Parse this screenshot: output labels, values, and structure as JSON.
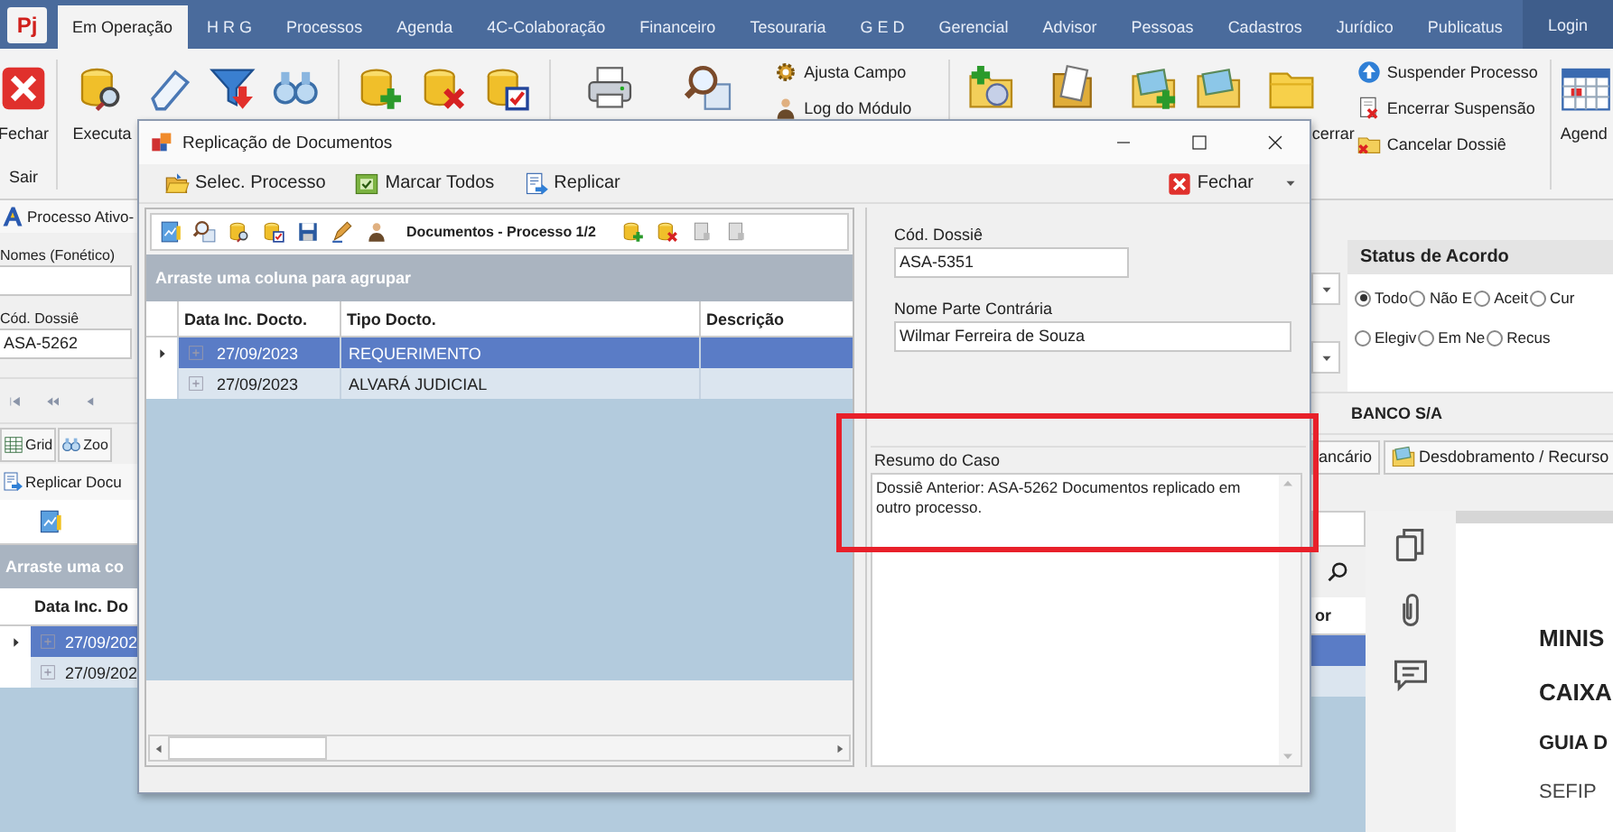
{
  "logo": "Pj",
  "tabs": [
    {
      "label": "Em Operação",
      "selected": true
    },
    {
      "label": "H R G",
      "selected": false
    },
    {
      "label": "Processos",
      "selected": false
    },
    {
      "label": "Agenda",
      "selected": false
    },
    {
      "label": "4C-Colaboração",
      "selected": false
    },
    {
      "label": "Financeiro",
      "selected": false
    },
    {
      "label": "Tesouraria",
      "selected": false
    },
    {
      "label": "G E D",
      "selected": false
    },
    {
      "label": "Gerencial",
      "selected": false
    },
    {
      "label": "Advisor",
      "selected": false
    },
    {
      "label": "Pessoas",
      "selected": false
    },
    {
      "label": "Cadastros",
      "selected": false
    },
    {
      "label": "Jurídico",
      "selected": false
    },
    {
      "label": "Publicatus",
      "selected": false
    }
  ],
  "login": "Login",
  "ribbon": {
    "close": "Fechar",
    "execute": "Executa",
    "group_label": "Sair",
    "small_actions_a": [
      "Ajusta Campo",
      "Log do Módulo"
    ],
    "folder_label": "cerrar",
    "small_actions_b": [
      "Suspender Processo",
      "Encerrar Suspensão",
      "Cancelar Dossiê"
    ],
    "agenda": "Agend"
  },
  "left_panel": {
    "active_process": "Processo Ativo-",
    "names_label": "Nomes (Fonético)",
    "dossier_label": "Cód. Dossiê",
    "dossier_value": "ASA-5262",
    "toolbar": [
      "Grid",
      "Zoo"
    ],
    "replicate": "Replicar Docu",
    "group_hint": "Arraste uma co",
    "column": "Data Inc. Do",
    "rows": [
      {
        "date": "27/09/202",
        "selected": true
      },
      {
        "date": "27/09/202",
        "selected": false
      }
    ]
  },
  "right_panel": {
    "status": {
      "title": "Status de Acordo",
      "options": [
        {
          "label": "Todo",
          "selected": true
        },
        {
          "label": "Não E",
          "selected": false
        },
        {
          "label": "Aceit",
          "selected": false
        },
        {
          "label": "Cur",
          "selected": false
        },
        {
          "label": "Elegiv",
          "selected": false
        },
        {
          "label": "Em Ne",
          "selected": false
        },
        {
          "label": "Recus",
          "selected": false
        }
      ]
    },
    "bank": "BANCO S/A",
    "buttons": [
      "ancário",
      "Desdobramento / Recurso"
    ],
    "column": "or",
    "rows": [
      {
        "selected": true
      },
      {
        "selected": false
      }
    ],
    "document": [
      "MINIS",
      "CAIXA",
      "GUIA D",
      "SEFIP"
    ]
  },
  "dialog": {
    "title": "Replicação de Documentos",
    "toolbar": [
      "Selec. Processo",
      "Marcar Todos",
      "Replicar"
    ],
    "close": "Fechar",
    "grid": {
      "caption": "Documentos - Processo 1/2",
      "group_hint": "Arraste uma coluna para agrupar",
      "columns": [
        "Data Inc. Docto.",
        "Tipo Docto.",
        "Descrição"
      ],
      "rows": [
        {
          "date": "27/09/2023",
          "type": "REQUERIMENTO",
          "selected": true
        },
        {
          "date": "27/09/2023",
          "type": "ALVARÁ JUDICIAL",
          "selected": false
        }
      ]
    },
    "form": {
      "dossier_label": "Cód. Dossiê",
      "dossier_value": "ASA-5351",
      "party_label": "Nome Parte Contrária",
      "party_value": "Wilmar Ferreira de Souza",
      "summary_label": "Resumo do Caso",
      "summary_value": "Dossiê Anterior: ASA-5262 Documentos replicado em outro processo."
    }
  }
}
